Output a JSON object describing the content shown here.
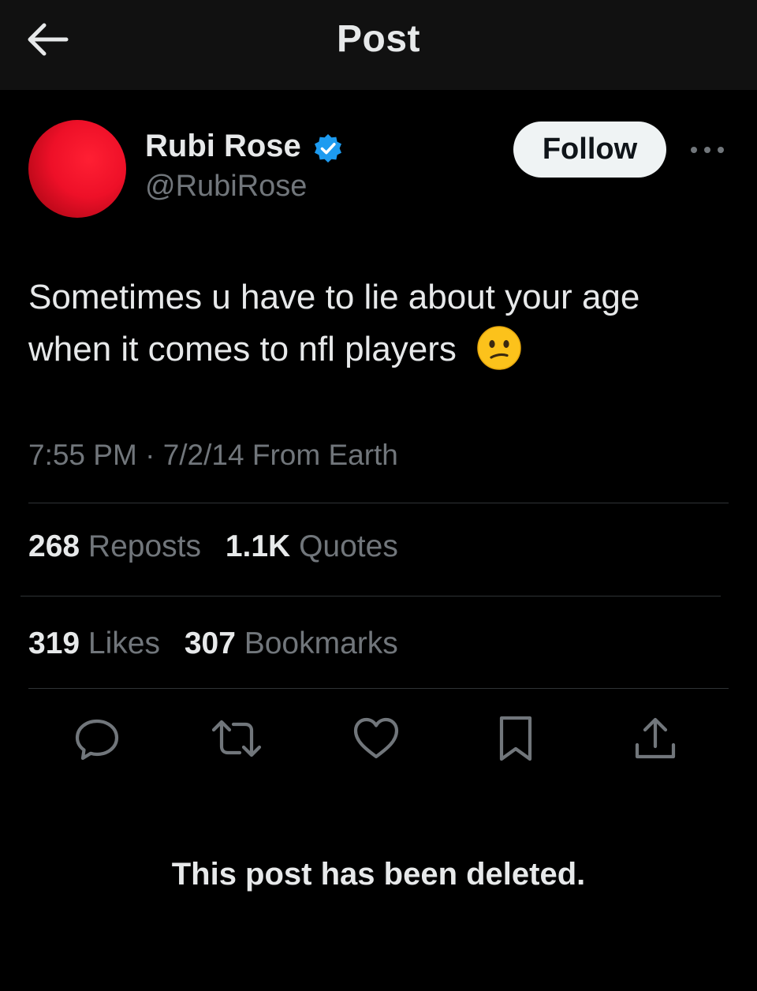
{
  "header": {
    "title": "Post",
    "back_icon": "arrow-left-icon"
  },
  "author": {
    "name": "Rubi Rose",
    "handle": "@RubiRose",
    "verified": true,
    "verified_color": "#1d9bf0",
    "avatar_color": "#ee1028"
  },
  "follow_button": {
    "label": "Follow"
  },
  "more_icon": "more-horizontal-icon",
  "post": {
    "text": "Sometimes u have to lie about your age when it comes to nfl players",
    "emoji": "😕",
    "time": "7:55 PM",
    "separator": "·",
    "date": "7/2/14",
    "source": "From Earth"
  },
  "stats": {
    "reposts": {
      "count": "268",
      "label": "Reposts"
    },
    "quotes": {
      "count": "1.1K",
      "label": "Quotes"
    },
    "likes": {
      "count": "319",
      "label": "Likes"
    },
    "bookmarks": {
      "count": "307",
      "label": "Bookmarks"
    }
  },
  "actions": [
    {
      "icon": "reply-icon"
    },
    {
      "icon": "repost-icon"
    },
    {
      "icon": "like-icon"
    },
    {
      "icon": "bookmark-icon"
    },
    {
      "icon": "share-icon"
    }
  ],
  "notice": "This post has been deleted.",
  "colors": {
    "background": "#000000",
    "header_background": "#111111",
    "text_primary": "#e7e9ea",
    "text_secondary": "#71767b",
    "divider": "#2f3336",
    "follow_bg": "#eff3f4"
  }
}
